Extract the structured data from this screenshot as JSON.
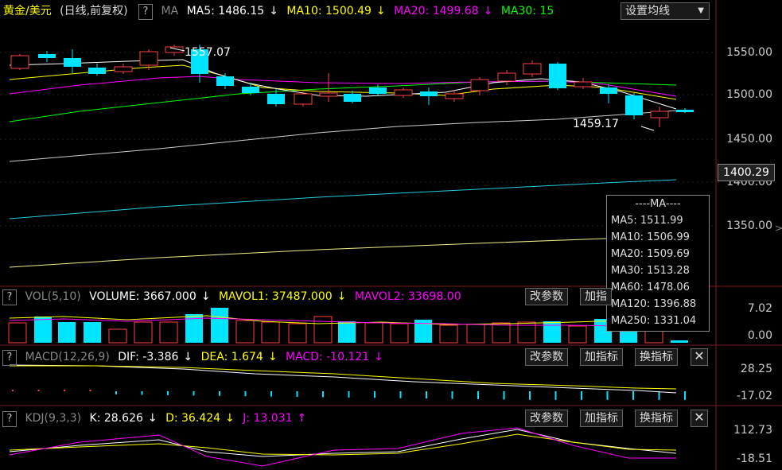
{
  "main": {
    "symbol": "黄金/美元",
    "period": "(日线,前复权)",
    "help": "?",
    "indicator": "MA",
    "ma_labels": [
      {
        "text": "MA5: 1486.15",
        "color": "#ffffff"
      },
      {
        "text": "MA10: 1500.49",
        "color": "#ffff00"
      },
      {
        "text": "MA20: 1499.68",
        "color": "#ff00ff"
      },
      {
        "text": "MA30: 15",
        "color": "#00ff00"
      }
    ],
    "arrows": [
      "↓",
      "↓",
      "↓"
    ],
    "settings_button": "设置均线",
    "high_label": "1557.07",
    "low_label": "1459.17",
    "price_ticks": [
      "1550.00",
      "1500.00",
      "1450.00",
      "1400.00",
      "1350.00"
    ],
    "current_price": "1400.29"
  },
  "tooltip": {
    "title": "----MA----",
    "rows": [
      "MA5: 1511.99",
      "MA10: 1506.99",
      "MA20: 1509.69",
      "MA30: 1513.28",
      "MA60: 1478.06",
      "MA120: 1396.88",
      "MA250: 1331.04"
    ]
  },
  "vol": {
    "help": "?",
    "name": "VOL(5,10)",
    "volume": "VOLUME: 3667.000",
    "mavol1": "MAVOL1: 37487.000",
    "mavol2": "MAVOL2: 33698.00",
    "arrows": [
      "↓",
      "↓"
    ],
    "btn_params": "改参数",
    "btn_add": "加指",
    "ticks": [
      "7.02",
      "0.00"
    ]
  },
  "macd": {
    "help": "?",
    "name": "MACD(12,26,9)",
    "dif": "DIF: -3.386",
    "dea": "DEA: 1.674",
    "macd": "MACD: -10.121",
    "arrows": [
      "↓",
      "↓",
      "↓"
    ],
    "btn_params": "改参数",
    "btn_add": "加指标",
    "btn_switch": "换指标",
    "btn_close": "✕",
    "ticks": [
      "28.25",
      "-17.02"
    ]
  },
  "kdj": {
    "help": "?",
    "name": "KDJ(9,3,3)",
    "k": "K: 28.626",
    "d": "D: 36.424",
    "j": "J: 13.031",
    "arrows": [
      "↓",
      "↓",
      "↑"
    ],
    "btn_params": "改参数",
    "btn_add": "加指标",
    "btn_switch": "换指标",
    "btn_close": "✕",
    "ticks": [
      "112.73",
      "-18.51"
    ]
  },
  "colors": {
    "up": "#ff4040",
    "down": "#00e5ff",
    "ma5": "#ffffff",
    "ma10": "#ffff00",
    "ma20": "#ff00ff",
    "ma30": "#00ff00",
    "ma60": "#cccccc",
    "ma120": "#22ccdd",
    "ma250": "#eeee88"
  }
}
